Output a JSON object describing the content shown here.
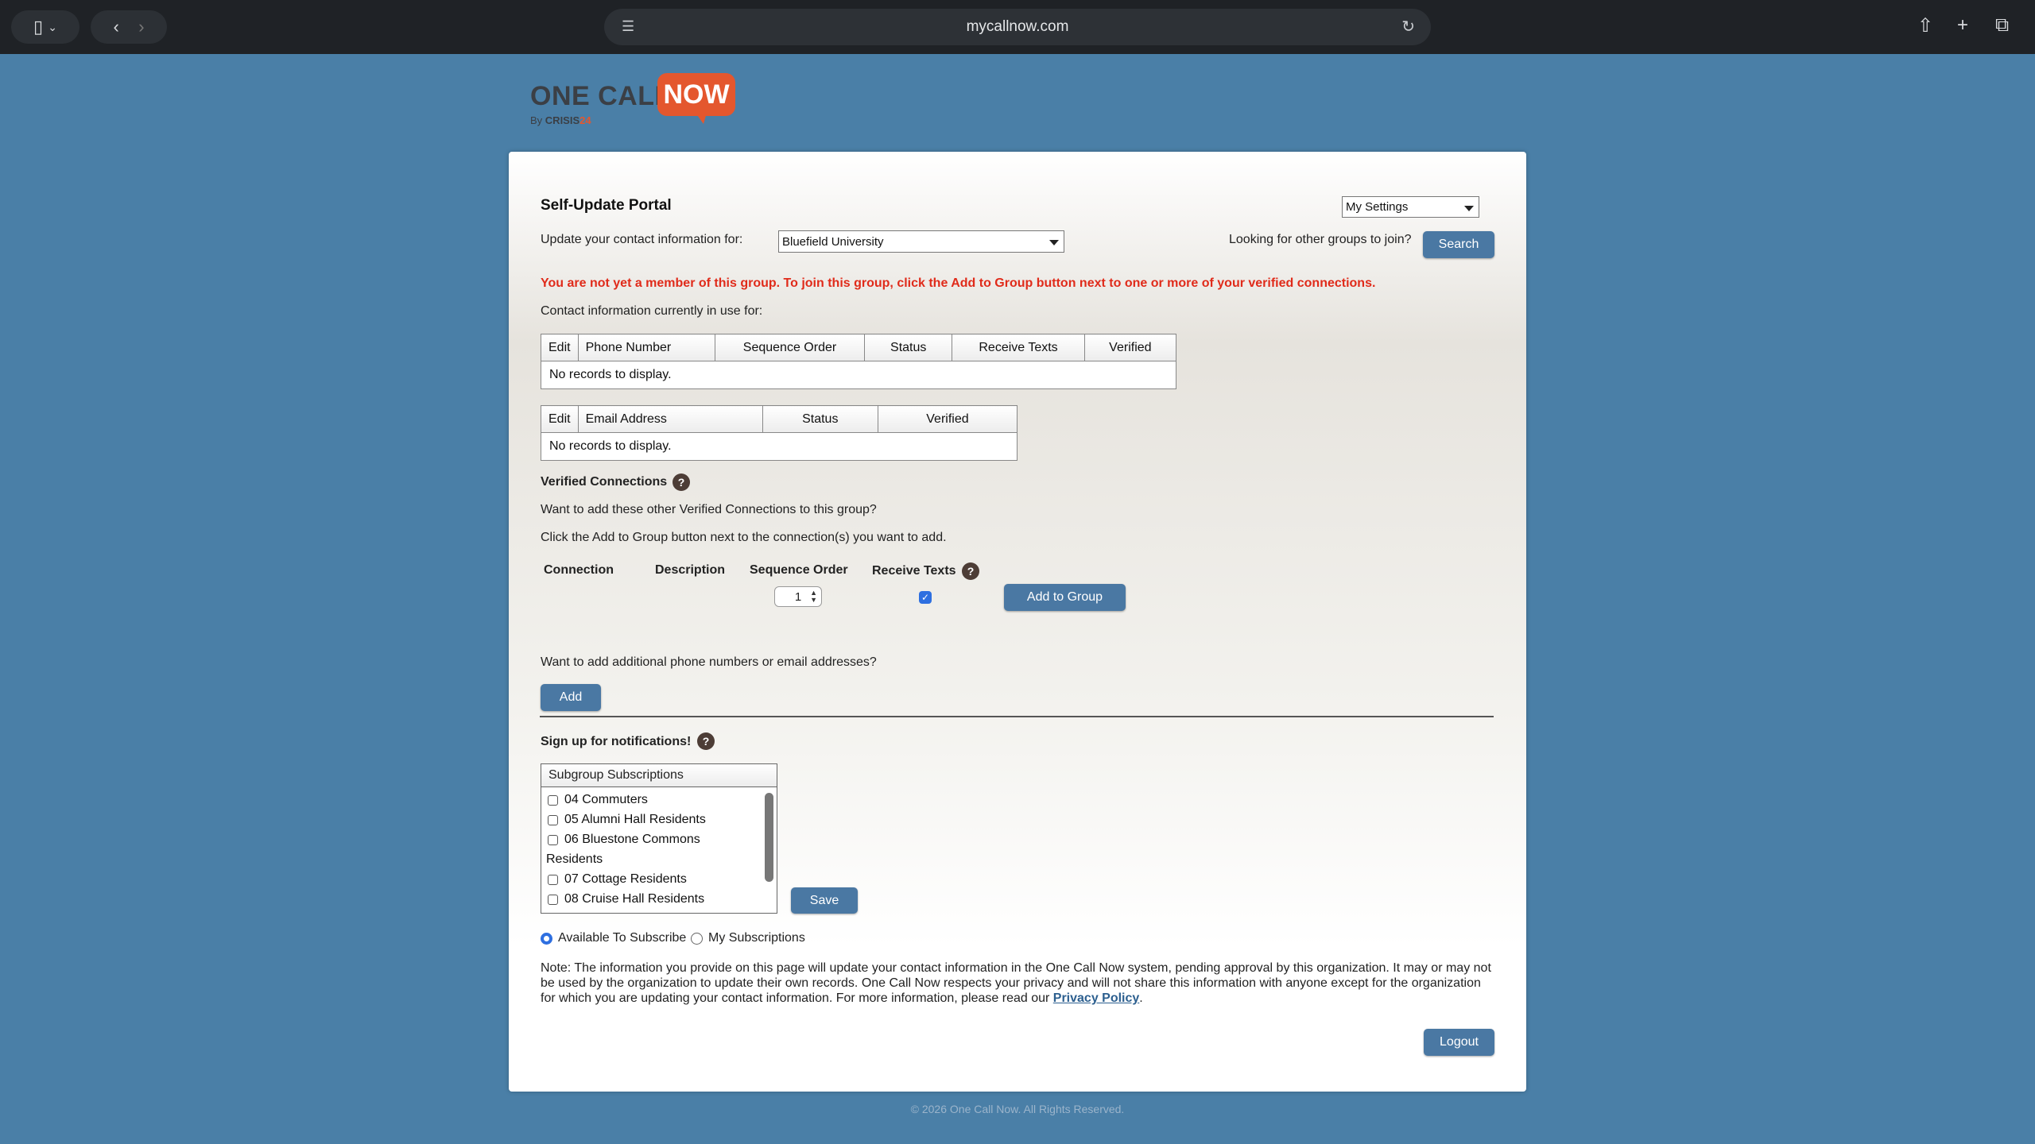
{
  "browser": {
    "url": "mycallnow.com"
  },
  "logo": {
    "one_call": "ONE CALL",
    "now": "NOW",
    "by": "By",
    "crisis": "CRISIS",
    "go": "24"
  },
  "portal": {
    "title": "Self-Update Portal",
    "settings_select": "My Settings",
    "update_label": "Update your contact information for:",
    "group_select": "Bluefield University",
    "looking_label": "Looking for other groups to join?",
    "search_button": "Search",
    "warning": "You are not yet a member of this group. To join this group, click the Add to Group button next to one or more of your verified connections.",
    "contact_label": "Contact information currently in use for:"
  },
  "phone_table": {
    "headers": [
      "Edit",
      "Phone Number",
      "Sequence Order",
      "Status",
      "Receive Texts",
      "Verified"
    ],
    "empty": "No records to display."
  },
  "email_table": {
    "headers": [
      "Edit",
      "Email Address",
      "Status",
      "Verified"
    ],
    "empty": "No records to display."
  },
  "verified": {
    "title": "Verified Connections",
    "line1": "Want to add these other Verified Connections to this group?",
    "line2": "Click the Add to Group button next to the connection(s) you want to add.",
    "headers": {
      "connection": "Connection",
      "description": "Description",
      "sequence": "Sequence Order",
      "receive": "Receive Texts"
    },
    "sequence_value": "1",
    "receive_checked": true,
    "add_to_group": "Add to Group"
  },
  "additional": {
    "label": "Want to add additional phone numbers or email addresses?",
    "add_button": "Add"
  },
  "signup": {
    "title": "Sign up for notifications!",
    "box_header": "Subgroup Subscriptions",
    "items": [
      "04 Commuters",
      "05 Alumni Hall Residents",
      "06 Bluestone Commons",
      "Residents",
      "07 Cottage Residents",
      "08 Cruise Hall Residents"
    ],
    "save_button": "Save",
    "radio_available": "Available To Subscribe",
    "radio_mine": "My Subscriptions",
    "selected": "Available To Subscribe"
  },
  "note": {
    "text": "Note: The information you provide on this page will update your contact information in the One Call Now system, pending approval by this organization. It may or may not be used by the organization to update their own records. One Call Now respects your privacy and will not share this information with anyone except for the organization for which you are updating your contact information. For more information, please read our ",
    "link": "Privacy Policy",
    "end": "."
  },
  "logout_button": "Logout",
  "footer": "© 2026 One Call Now. All Rights Reserved.",
  "colors": {
    "background": "#4a7fa7",
    "button": "#4a78a3",
    "warning": "#e02b1a",
    "accent": "#e4572e"
  }
}
